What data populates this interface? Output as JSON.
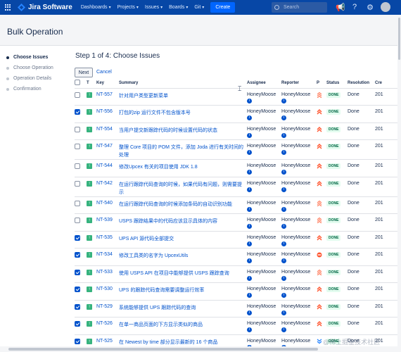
{
  "topbar": {
    "product_name": "Jira Software",
    "nav": [
      {
        "label": "Dashboards"
      },
      {
        "label": "Projects"
      },
      {
        "label": "Issues"
      },
      {
        "label": "Boards"
      },
      {
        "label": "Git"
      }
    ],
    "create_label": "Create",
    "search_placeholder": "Search",
    "accent_color": "#0747a6"
  },
  "page": {
    "title": "Bulk Operation",
    "step_heading": "Step 1 of 4: Choose Issues",
    "steps": [
      {
        "label": "Choose Issues",
        "active": true
      },
      {
        "label": "Choose Operation",
        "active": false
      },
      {
        "label": "Operation Details",
        "active": false
      },
      {
        "label": "Confirmation",
        "active": false
      }
    ],
    "next_label": "Next",
    "cancel_label": "Cancel"
  },
  "table": {
    "columns": [
      "T",
      "Key",
      "Summary",
      "Assignee",
      "Reporter",
      "P",
      "Status",
      "Resolution",
      "Cre"
    ],
    "rows": [
      {
        "checked": false,
        "key": "NT-557",
        "summary": "针对用户类型更新菜单",
        "assignee": "HoneyMoose",
        "reporter": "HoneyMoose",
        "priority": "major",
        "status": "DONE",
        "resolution": "Done",
        "created": "201"
      },
      {
        "checked": true,
        "key": "NT-556",
        "summary": "打包的zip 运行文件不包含版本号",
        "assignee": "HoneyMoose",
        "reporter": "HoneyMoose",
        "priority": "highest",
        "status": "DONE",
        "resolution": "Done",
        "created": "201"
      },
      {
        "checked": false,
        "key": "NT-554",
        "summary": "当用户提交新跟踪代码的时候设置代码的状态",
        "assignee": "HoneyMoose",
        "reporter": "HoneyMoose",
        "priority": "highest",
        "status": "DONE",
        "resolution": "Done",
        "created": "201"
      },
      {
        "checked": false,
        "key": "NT-547",
        "summary": "整理 Core 项目的 POM 文件，添加 Joda 进行有关时间的处理",
        "assignee": "HoneyMoose",
        "reporter": "HoneyMoose",
        "priority": "highest",
        "status": "DONE",
        "resolution": "Done",
        "created": "201"
      },
      {
        "checked": false,
        "key": "NT-544",
        "summary": "修改Upcex 有关的项目使用 JDK 1.8",
        "assignee": "HoneyMoose",
        "reporter": "HoneyMoose",
        "priority": "highest",
        "status": "DONE",
        "resolution": "Done",
        "created": "201"
      },
      {
        "checked": false,
        "key": "NT-542",
        "summary": "在运行跟踪代码查询的时候，如果代码有问题，则需要提示",
        "assignee": "HoneyMoose",
        "reporter": "HoneyMoose",
        "priority": "highest",
        "status": "DONE",
        "resolution": "Done",
        "created": "201"
      },
      {
        "checked": false,
        "key": "NT-540",
        "summary": "在运行跟踪代码查询的时候添加条码的自动识别功能",
        "assignee": "HoneyMoose",
        "reporter": "HoneyMoose",
        "priority": "major",
        "status": "DONE",
        "resolution": "Done",
        "created": "201"
      },
      {
        "checked": false,
        "key": "NT-539",
        "summary": "USPS 跟踪结果中的代码应该显示具体的内容",
        "assignee": "HoneyMoose",
        "reporter": "HoneyMoose",
        "priority": "major",
        "status": "DONE",
        "resolution": "Done",
        "created": "201"
      },
      {
        "checked": true,
        "key": "NT-535",
        "summary": "UPS API 源代码全部提交",
        "assignee": "HoneyMoose",
        "reporter": "HoneyMoose",
        "priority": "highest",
        "status": "DONE",
        "resolution": "Done",
        "created": "201"
      },
      {
        "checked": true,
        "key": "NT-534",
        "summary": "修改工具类的名字为 UpcexUtils",
        "assignee": "HoneyMoose",
        "reporter": "HoneyMoose",
        "priority": "blocker",
        "status": "DONE",
        "resolution": "Done",
        "created": "201"
      },
      {
        "checked": true,
        "key": "NT-533",
        "summary": "使用 USPS API 在项目中能够提供 USPS 跟踪查询",
        "assignee": "HoneyMoose",
        "reporter": "HoneyMoose",
        "priority": "major",
        "status": "DONE",
        "resolution": "Done",
        "created": "201"
      },
      {
        "checked": true,
        "key": "NT-530",
        "summary": "UPS 的跟踪代码查询需要调整运行效率",
        "assignee": "HoneyMoose",
        "reporter": "HoneyMoose",
        "priority": "highest",
        "status": "DONE",
        "resolution": "Done",
        "created": "201"
      },
      {
        "checked": true,
        "key": "NT-529",
        "summary": "系统能够提供 UPS 跟踪代码的查询",
        "assignee": "HoneyMoose",
        "reporter": "HoneyMoose",
        "priority": "highest",
        "status": "DONE",
        "resolution": "Done",
        "created": "201"
      },
      {
        "checked": true,
        "key": "NT-526",
        "summary": "在单一商品页面的下方显示类似的商品",
        "assignee": "HoneyMoose",
        "reporter": "HoneyMoose",
        "priority": "highest",
        "status": "DONE",
        "resolution": "Done",
        "created": "201"
      },
      {
        "checked": true,
        "key": "NT-525",
        "summary": "在 Newest by time 部分显示最新的 16 个商品",
        "assignee": "HoneyMoose",
        "reporter": "HoneyMoose",
        "priority": "lowest",
        "status": "DONE",
        "resolution": "Done",
        "created": "201"
      }
    ]
  },
  "watermark": "@稀土掘金技术社区"
}
